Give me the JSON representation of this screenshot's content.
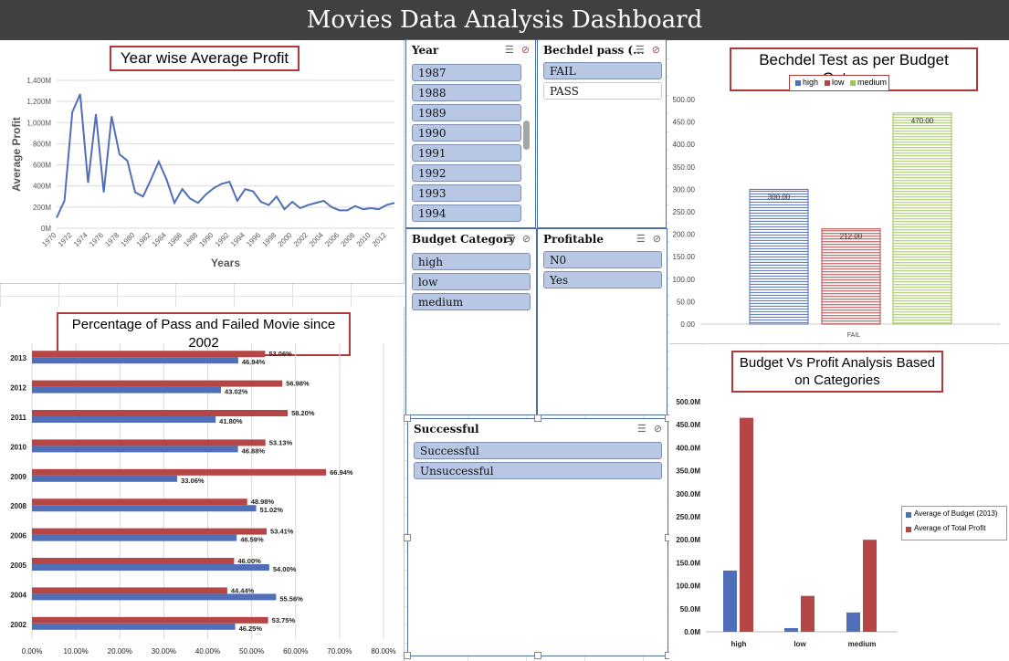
{
  "title": "Movies Data Analysis Dashboard",
  "colors": {
    "blue": "#4f6fb8",
    "red": "#b64646",
    "green": "#9dc658",
    "title_border": "#b03a3a"
  },
  "year_chart": {
    "title": "Year wise Average Profit",
    "xlabel": "Years",
    "ylabel": "Average Profit",
    "yticks": [
      "0M",
      "200M",
      "400M",
      "600M",
      "800M",
      "1,000M",
      "1,200M",
      "1,400M"
    ],
    "xticks": [
      "1970",
      "1972",
      "1974",
      "1976",
      "1978",
      "1980",
      "1982",
      "1984",
      "1986",
      "1988",
      "1990",
      "1992",
      "1994",
      "1996",
      "1998",
      "2000",
      "2002",
      "2004",
      "2006",
      "2008",
      "2010",
      "2012"
    ]
  },
  "pass_fail_chart": {
    "title": "Percentage of Pass and Failed Movie since 2002",
    "xticks": [
      "0.00%",
      "10.00%",
      "20.00%",
      "30.00%",
      "40.00%",
      "50.00%",
      "60.00%",
      "70.00%",
      "80.00%"
    ]
  },
  "bechdel_chart": {
    "title": "Bechdel Test as per Budget Category",
    "legend": [
      "high",
      "low",
      "medium"
    ],
    "yticks": [
      "0.00",
      "50.00",
      "100.00",
      "150.00",
      "200.00",
      "250.00",
      "300.00",
      "350.00",
      "400.00",
      "450.00",
      "500.00"
    ],
    "xcat": "FAIL",
    "labels": [
      "300.00",
      "212.00",
      "470.00"
    ]
  },
  "budget_chart": {
    "title": "Budget Vs Profit Analysis Based on Categories",
    "legend": [
      "Average of Budget (2013)",
      "Average of Total Profit"
    ],
    "yticks": [
      "0.0M",
      "50.0M",
      "100.0M",
      "150.0M",
      "200.0M",
      "250.0M",
      "300.0M",
      "350.0M",
      "400.0M",
      "450.0M",
      "500.0M"
    ],
    "categories": [
      "high",
      "low",
      "medium"
    ]
  },
  "slicers": {
    "year": {
      "title": "Year",
      "items": [
        "1987",
        "1988",
        "1989",
        "1990",
        "1991",
        "1992",
        "1993",
        "1994"
      ]
    },
    "bechdel": {
      "title": "Bechdel pass (...",
      "items": [
        "FAIL",
        "PASS"
      ]
    },
    "budget_category": {
      "title": "Budget Category",
      "items": [
        "high",
        "low",
        "medium"
      ]
    },
    "profitable": {
      "title": "Profitable",
      "items": [
        "N0",
        "Yes"
      ]
    },
    "successful": {
      "title": "Successful",
      "items": [
        "Successful",
        "Unsuccessful"
      ]
    }
  },
  "chart_data": [
    {
      "type": "line",
      "title": "Year wise Average Profit",
      "xlabel": "Years",
      "ylabel": "Average Profit",
      "ylim": [
        0,
        1400
      ],
      "x": [
        1970,
        1971,
        1972,
        1973,
        1974,
        1975,
        1976,
        1977,
        1978,
        1979,
        1980,
        1981,
        1982,
        1983,
        1984,
        1985,
        1986,
        1987,
        1988,
        1989,
        1990,
        1991,
        1992,
        1993,
        1994,
        1995,
        1996,
        1997,
        1998,
        1999,
        2000,
        2001,
        2002,
        2003,
        2004,
        2005,
        2006,
        2007,
        2008,
        2009,
        2010,
        2011,
        2012,
        2013
      ],
      "series": [
        {
          "values": [
            100,
            260,
            1100,
            1270,
            430,
            1080,
            340,
            1060,
            700,
            640,
            340,
            300,
            460,
            630,
            460,
            240,
            370,
            280,
            240,
            320,
            380,
            420,
            440,
            260,
            370,
            350,
            250,
            220,
            300,
            180,
            250,
            190,
            220,
            240,
            260,
            200,
            170,
            170,
            210,
            180,
            190,
            180,
            220,
            240
          ]
        }
      ]
    },
    {
      "type": "bar",
      "title": "Percentage of Pass and Failed Movie since 2002",
      "categories": [
        "2013",
        "2012",
        "2011",
        "2010",
        "2009",
        "2008",
        "2006",
        "2005",
        "2004",
        "2002"
      ],
      "xlim": [
        0,
        80
      ],
      "series": [
        {
          "values": [
            53.06,
            56.98,
            58.2,
            53.13,
            66.94,
            48.98,
            53.41,
            46.0,
            44.44,
            53.75
          ],
          "labels": [
            "53.06%",
            "56.98%",
            "58.20%",
            "53.13%",
            "66.94%",
            "48.98%",
            "53.41%",
            "46.00%",
            "44.44%",
            "53.75%"
          ]
        },
        {
          "values": [
            46.94,
            43.02,
            41.8,
            46.88,
            33.06,
            51.02,
            46.59,
            54.0,
            55.56,
            46.25
          ],
          "labels": [
            "46.94%",
            "43.02%",
            "41.80%",
            "46.88%",
            "33.06%",
            "51.02%",
            "46.59%",
            "54.00%",
            "55.56%",
            "46.25%"
          ]
        }
      ]
    },
    {
      "type": "bar",
      "title": "Bechdel Test as per Budget Category",
      "categories": [
        "FAIL"
      ],
      "ylim": [
        0,
        500
      ],
      "series": [
        {
          "name": "high",
          "values": [
            300
          ]
        },
        {
          "name": "low",
          "values": [
            212
          ]
        },
        {
          "name": "medium",
          "values": [
            470
          ]
        }
      ]
    },
    {
      "type": "bar",
      "title": "Budget Vs Profit Analysis Based on Categories",
      "categories": [
        "high",
        "low",
        "medium"
      ],
      "ylim": [
        0,
        500
      ],
      "series": [
        {
          "name": "Average of Budget (2013)",
          "values": [
            133,
            8,
            42
          ]
        },
        {
          "name": "Average of Total Profit",
          "values": [
            465,
            78,
            200
          ]
        }
      ]
    }
  ]
}
